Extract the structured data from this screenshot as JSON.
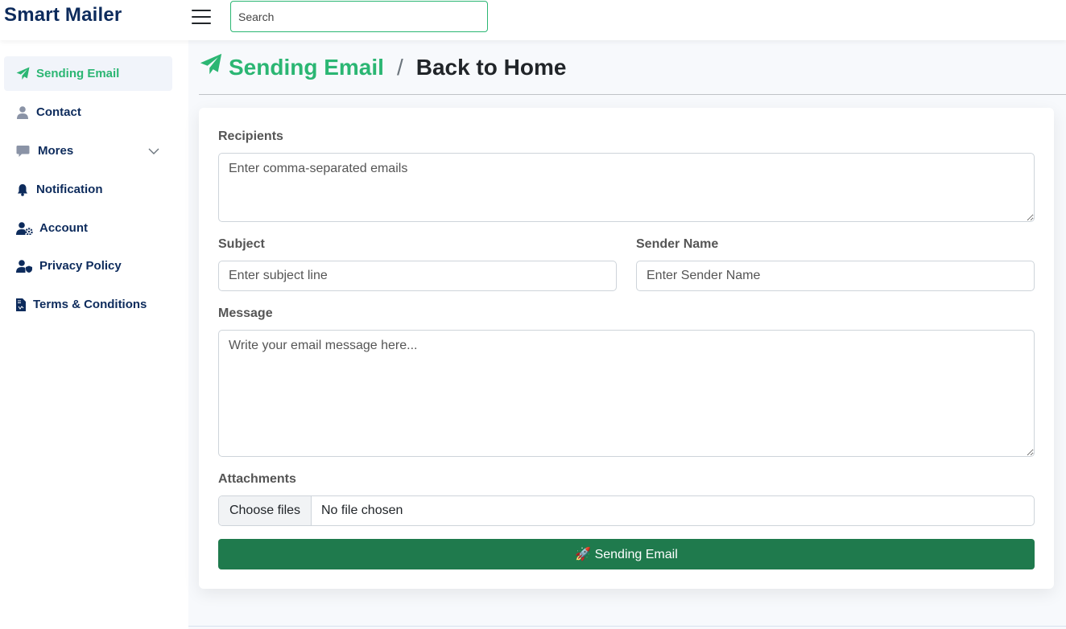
{
  "app": {
    "brand": "Smart Mailer"
  },
  "header": {
    "search_placeholder": "Search"
  },
  "sidebar": {
    "items": [
      {
        "label": "Sending Email",
        "icon": "paper-plane-icon",
        "active": true
      },
      {
        "label": "Contact",
        "icon": "user-icon"
      },
      {
        "label": "Mores",
        "icon": "comment-icon",
        "has_dropdown": true
      },
      {
        "label": "Notification",
        "icon": "bell-icon"
      },
      {
        "label": "Account",
        "icon": "user-gear-icon"
      },
      {
        "label": "Privacy Policy",
        "icon": "user-shield-icon"
      },
      {
        "label": "Terms & Conditions",
        "icon": "file-contract-icon"
      }
    ]
  },
  "breadcrumb": {
    "current": "Sending Email",
    "separator": "/",
    "home": "Back to Home"
  },
  "form": {
    "recipients_label": "Recipients",
    "recipients_placeholder": "Enter comma-separated emails",
    "subject_label": "Subject",
    "subject_placeholder": "Enter subject line",
    "sender_label": "Sender Name",
    "sender_placeholder": "Enter Sender Name",
    "message_label": "Message",
    "message_placeholder": "Write your email message here...",
    "attachments_label": "Attachments",
    "file_button": "Choose files",
    "file_status": "No file chosen",
    "submit_label": "🚀 Sending Email"
  },
  "colors": {
    "brand": "#0d2b5c",
    "accent": "#2bb673",
    "submit": "#1f7a4d"
  }
}
